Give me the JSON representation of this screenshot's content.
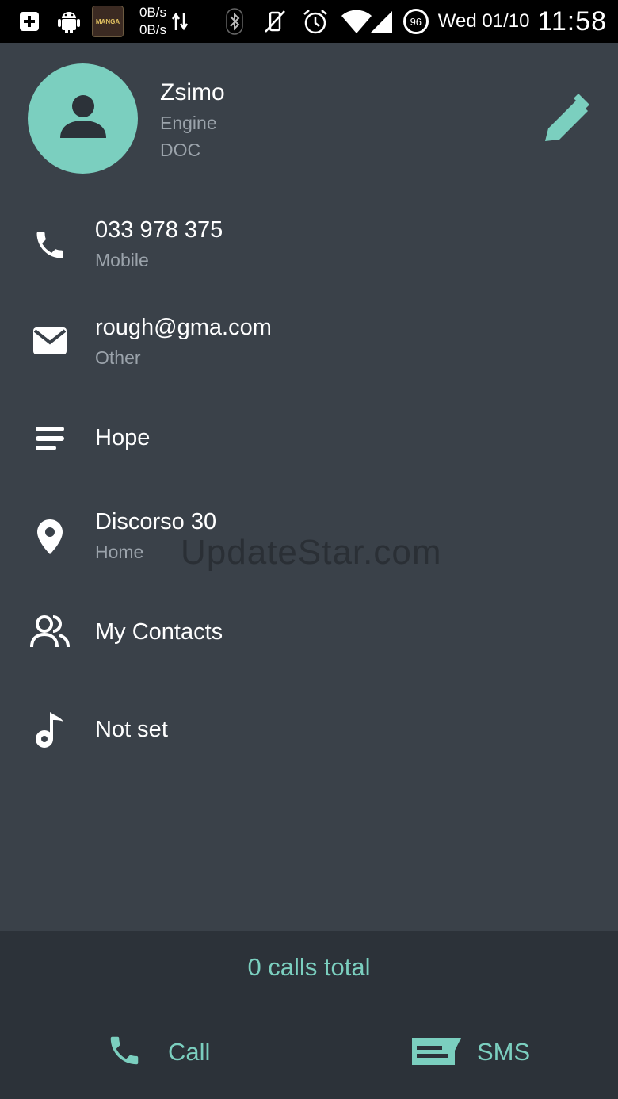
{
  "status_bar": {
    "net_up": "0B/s",
    "net_down": "0B/s",
    "thumb_text": "MANGA",
    "battery_level": "96",
    "date": "Wed 01/10",
    "time": "11:58",
    "icons": [
      "add-notification-icon",
      "android-debug-icon",
      "app-thumbnail-icon",
      "data-transfer-icon",
      "bluetooth-icon",
      "vibrate-off-icon",
      "alarm-icon",
      "wifi-icon",
      "signal-icon",
      "battery-icon"
    ]
  },
  "contact": {
    "name": "Zsimo",
    "company": "Engine",
    "title": "DOC"
  },
  "details": [
    {
      "icon": "phone-icon",
      "primary": "033 978 375",
      "secondary": "Mobile"
    },
    {
      "icon": "email-icon",
      "primary": "rough@gma.com",
      "secondary": "Other"
    },
    {
      "icon": "notes-icon",
      "primary": "Hope",
      "secondary": ""
    },
    {
      "icon": "location-icon",
      "primary": "Discorso 30",
      "secondary": "Home"
    },
    {
      "icon": "group-icon",
      "primary": "My Contacts",
      "secondary": ""
    },
    {
      "icon": "ringtone-icon",
      "primary": "Not set",
      "secondary": ""
    }
  ],
  "watermark": "UpdateStar.com",
  "footer": {
    "calls_total": "0 calls total",
    "call_label": "Call",
    "sms_label": "SMS"
  },
  "colors": {
    "accent": "#7bcfbf",
    "background": "#3a4149",
    "footer_background": "#2c3239",
    "secondary_text": "#9ba3ab"
  }
}
